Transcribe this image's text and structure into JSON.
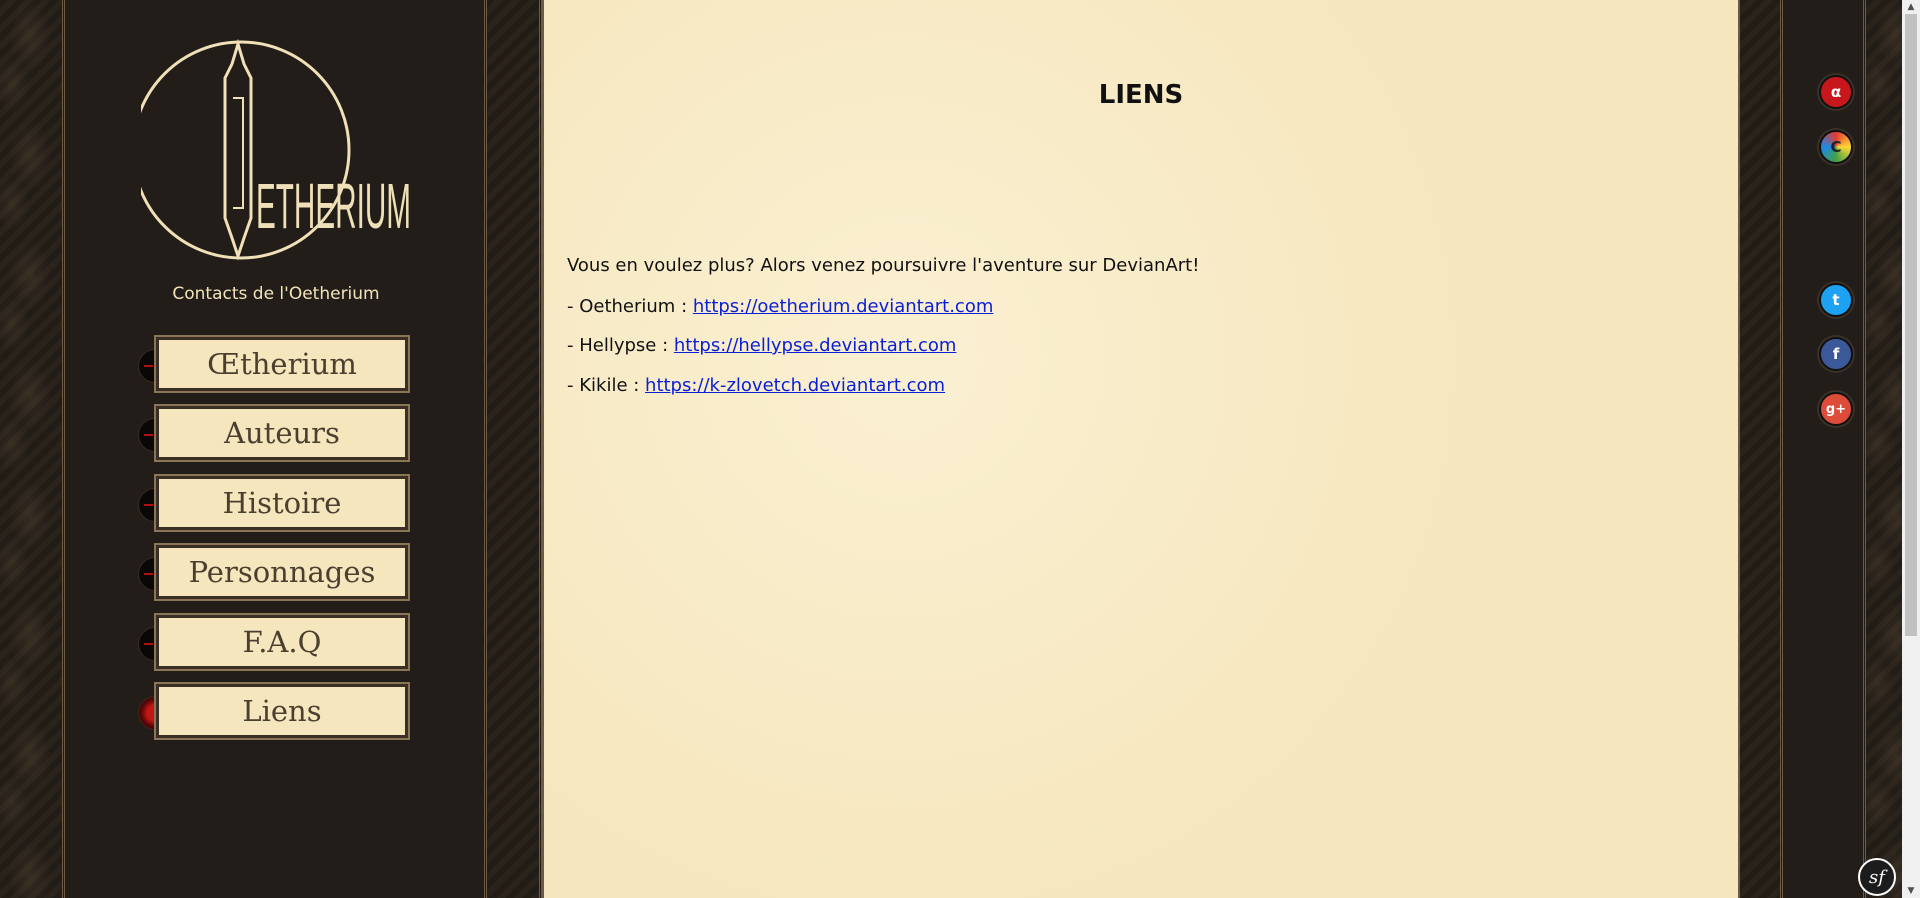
{
  "sidebar": {
    "logo_alt": "Oetherium",
    "contacts_label": "Contacts de l'Oetherium",
    "nav": [
      {
        "label": "Œtherium",
        "active": false
      },
      {
        "label": "Auteurs",
        "active": false
      },
      {
        "label": "Histoire",
        "active": false
      },
      {
        "label": "Personnages",
        "active": false
      },
      {
        "label": "F.A.Q",
        "active": false
      },
      {
        "label": "Liens",
        "active": true
      }
    ]
  },
  "main": {
    "title": "LIENS",
    "intro": "Vous en voulez plus? Alors venez poursuivre l'aventure sur DevianArt!",
    "links": [
      {
        "prefix": "- Oetherium : ",
        "url": "https://oetherium.deviantart.com"
      },
      {
        "prefix": "- Hellypse : ",
        "url": "https://hellypse.deviantart.com"
      },
      {
        "prefix": "- Kikile : ",
        "url": "https://k-zlovetch.deviantart.com"
      }
    ]
  },
  "social": {
    "icons": [
      "deviantart-icon",
      "color-c-icon",
      "twitter-icon",
      "facebook-icon",
      "google-plus-icon"
    ],
    "glyphs": [
      "α",
      "C",
      "t",
      "f",
      "g+"
    ],
    "colors": [
      "#c8161d",
      "#7a9a1a",
      "#1da1f2",
      "#3b5998",
      "#dd4b39"
    ]
  },
  "debug_badge": "sf"
}
